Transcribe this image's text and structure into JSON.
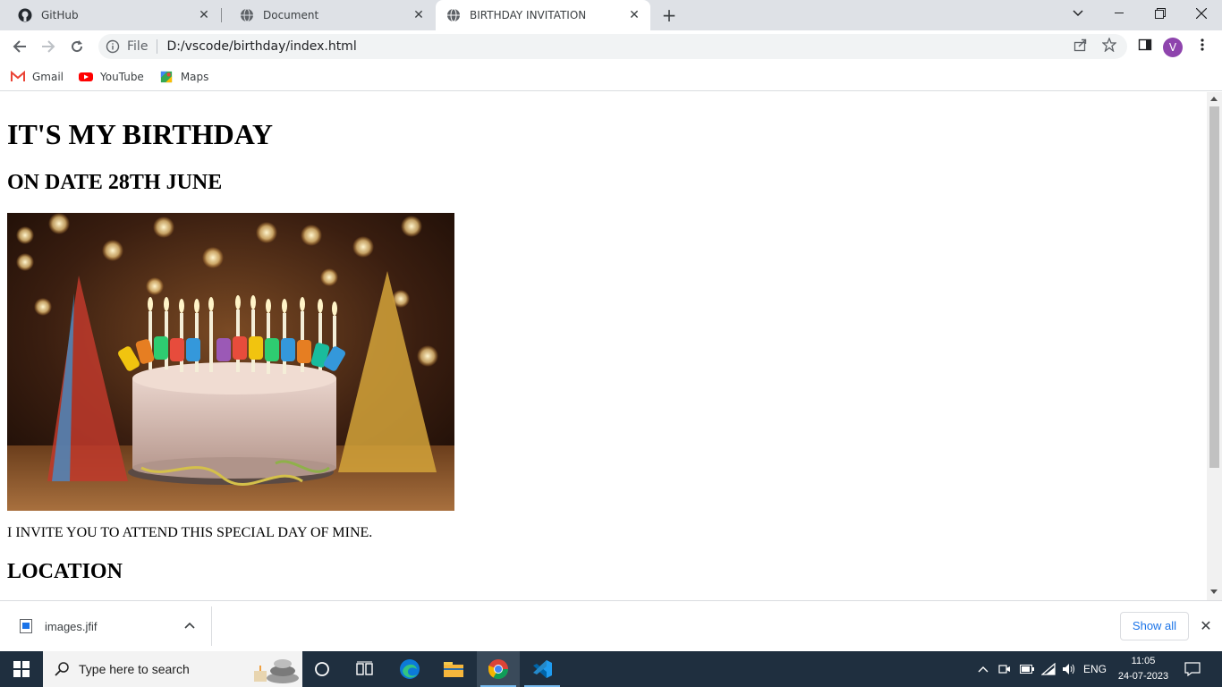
{
  "browser": {
    "tabs": [
      {
        "label": "GitHub",
        "icon": "github-icon"
      },
      {
        "label": "Document",
        "icon": "globe-icon"
      },
      {
        "label": "BIRTHDAY INVITATION",
        "icon": "globe-icon",
        "active": true
      }
    ],
    "address": {
      "scheme_label": "File",
      "url": "D:/vscode/birthday/index.html"
    },
    "profile_initial": "V",
    "bookmarks": [
      {
        "label": "Gmail",
        "icon": "gmail-icon"
      },
      {
        "label": "YouTube",
        "icon": "youtube-icon"
      },
      {
        "label": "Maps",
        "icon": "maps-icon"
      }
    ]
  },
  "page": {
    "title": "IT'S MY BIRTHDAY",
    "date_heading": "ON DATE 28TH JUNE",
    "image_alt": "birthday cake",
    "invite_text": "I INVITE YOU TO ATTEND THIS SPECIAL DAY OF MINE.",
    "location_heading": "LOCATION"
  },
  "downloads": {
    "file_name": "images.jfif",
    "show_all_label": "Show all"
  },
  "taskbar": {
    "search_placeholder": "Type here to search",
    "language": "ENG",
    "time": "11:05",
    "date": "24-07-2023"
  },
  "colors": {
    "tabstrip_bg": "#dee1e6",
    "taskbar_bg": "#1f2f3f",
    "accent_blue": "#1a73e8",
    "profile_purple": "#8e44ad"
  }
}
